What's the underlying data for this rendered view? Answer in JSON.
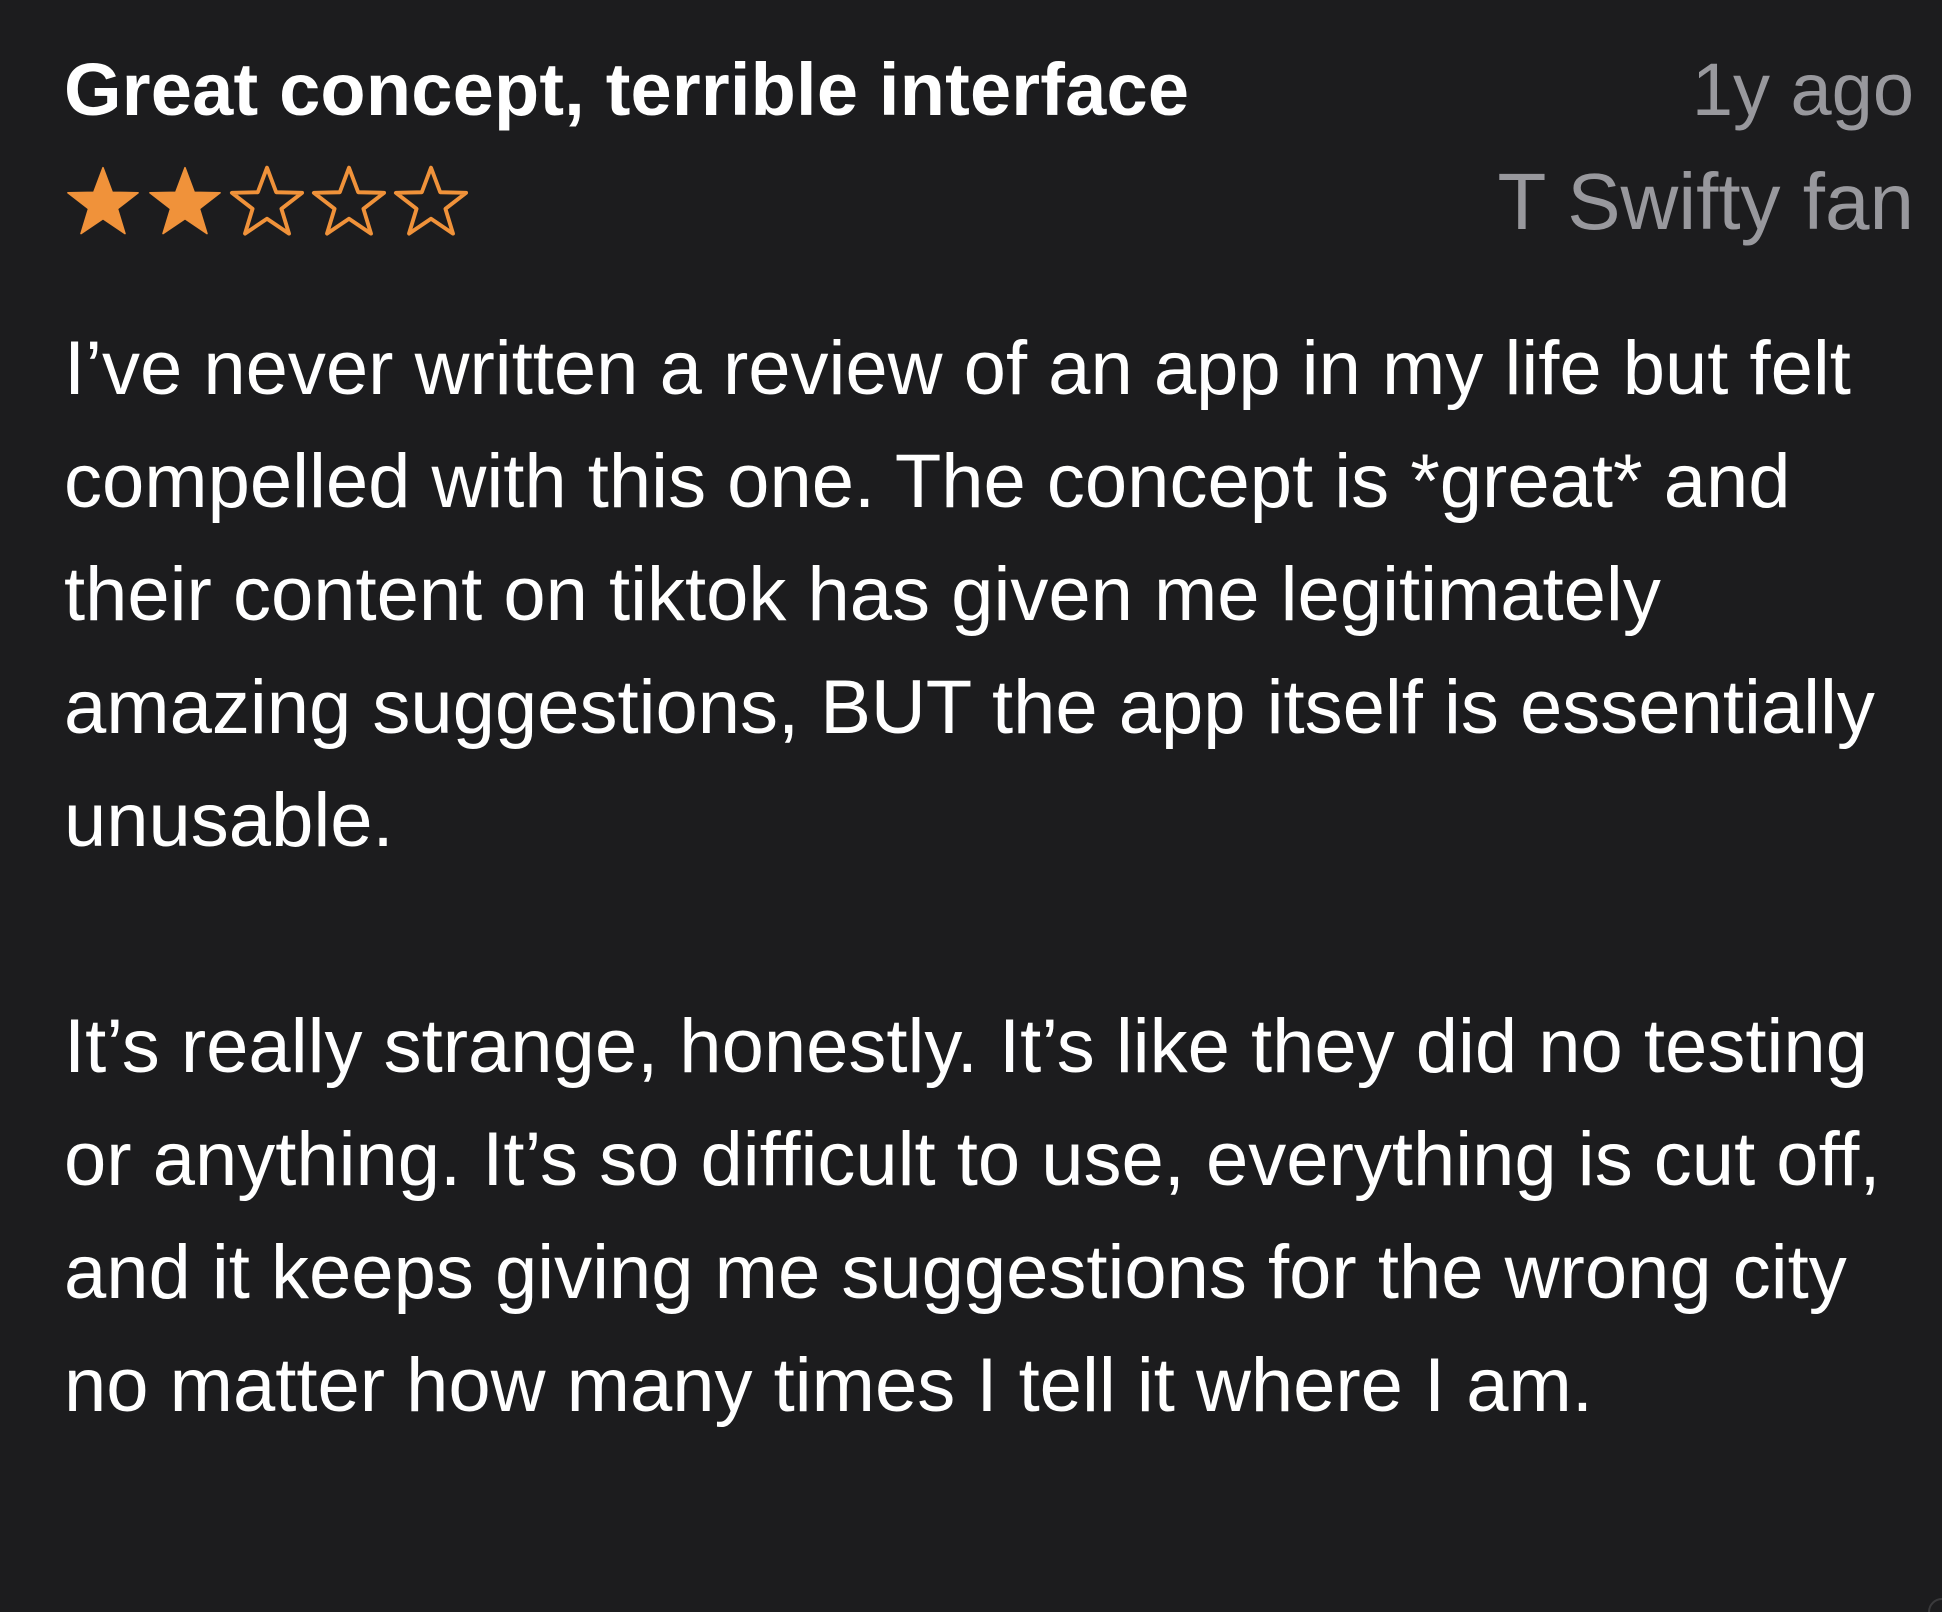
{
  "review": {
    "title": "Great concept, terrible interface",
    "date": "1y ago",
    "reviewer": "T Swifty fan",
    "rating": 2,
    "rating_max": 5,
    "star_color": "#f0923a",
    "paragraphs": [
      "I’ve never written a review of an app in my life but felt compelled with this one. The concept is *great* and their content on tiktok has given me legitimately amazing suggestions, BUT the app itself is essentially unusable.",
      "It’s really strange, honestly. It’s like they did no testing or anything. It’s so difficult to use, everything is cut off, and it keeps giving me suggestions for the wrong city no matter how many times I tell it where I am."
    ]
  },
  "colors": {
    "background": "#1c1c1e",
    "text_primary": "#ffffff",
    "text_secondary": "#98989d"
  }
}
